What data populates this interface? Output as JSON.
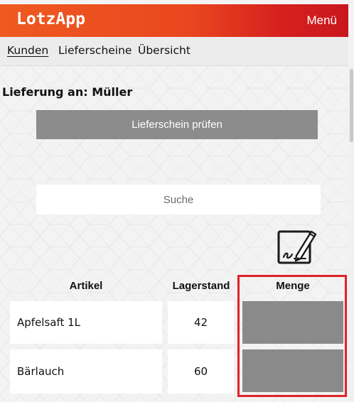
{
  "header": {
    "logo": "LotzApp",
    "menu_label": "Menü"
  },
  "nav": {
    "items": [
      {
        "label": "Kunden",
        "active": true
      },
      {
        "label": "Lieferscheine",
        "active": false
      },
      {
        "label": "Übersicht",
        "active": false
      }
    ]
  },
  "delivery": {
    "title": "Lieferung an: Müller"
  },
  "actions": {
    "check_label": "Lieferschein prüfen"
  },
  "search": {
    "placeholder": "Suche",
    "value": ""
  },
  "table": {
    "headers": {
      "article": "Artikel",
      "stock": "Lagerstand",
      "quantity": "Menge"
    },
    "rows": [
      {
        "article": "Apfelsaft 1L",
        "stock": "42",
        "quantity": ""
      },
      {
        "article": "Bärlauch",
        "stock": "60",
        "quantity": ""
      }
    ]
  },
  "icons": {
    "signature": "signature-pen-icon"
  },
  "colors": {
    "header_start": "#ef5a21",
    "header_end": "#c8171d",
    "button": "#8c8c8c",
    "quantity_field": "#8a8a8a",
    "highlight": "#e0222a"
  }
}
